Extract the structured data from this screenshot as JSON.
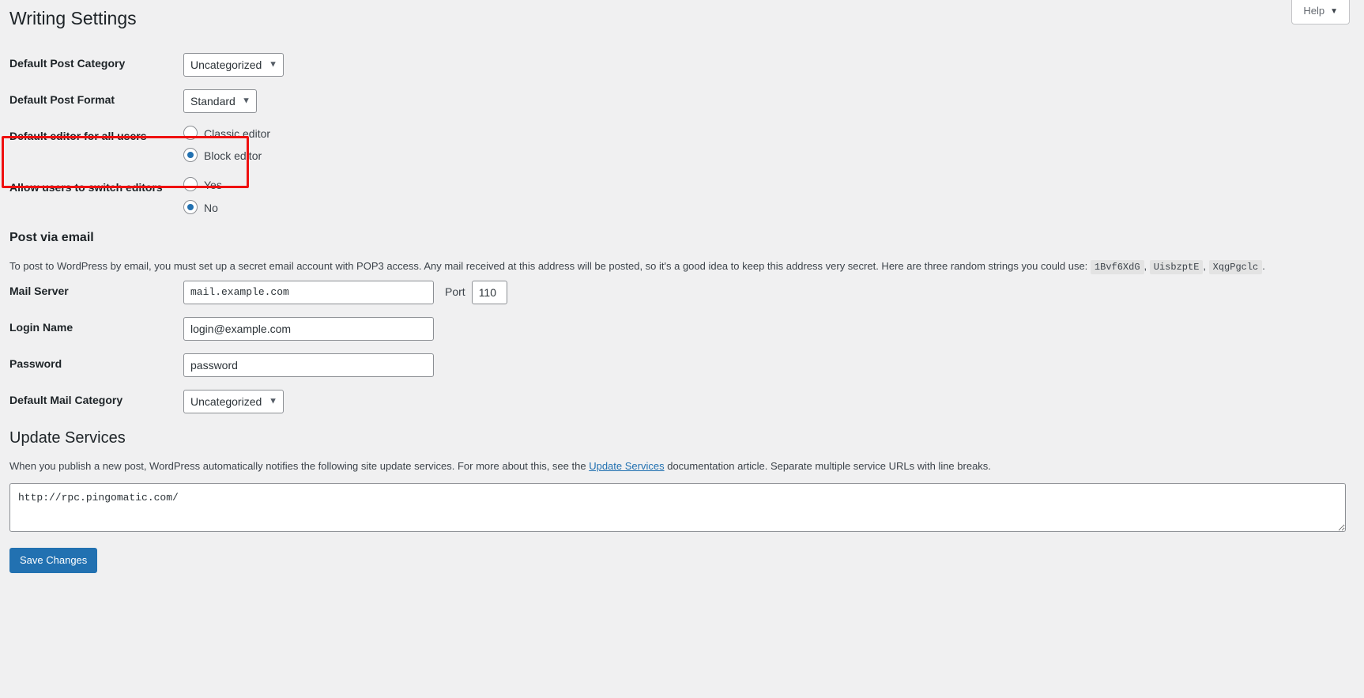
{
  "help_tab": {
    "label": "Help",
    "caret": "chevron-down-icon"
  },
  "page": {
    "title": "Writing Settings"
  },
  "fields": {
    "default_post_category": {
      "label": "Default Post Category",
      "value": "Uncategorized",
      "options": [
        "Uncategorized"
      ]
    },
    "default_post_format": {
      "label": "Default Post Format",
      "value": "Standard",
      "options": [
        "Standard"
      ]
    },
    "default_editor": {
      "label": "Default editor for all users",
      "options": [
        {
          "label": "Classic editor",
          "checked": false
        },
        {
          "label": "Block editor",
          "checked": true
        }
      ]
    },
    "allow_switch_editors": {
      "label": "Allow users to switch editors",
      "options": [
        {
          "label": "Yes",
          "checked": false
        },
        {
          "label": "No",
          "checked": true
        }
      ]
    },
    "mail_server": {
      "label": "Mail Server",
      "value": "mail.example.com",
      "port_label": "Port",
      "port_value": "110"
    },
    "login_name": {
      "label": "Login Name",
      "value": "login@example.com"
    },
    "password": {
      "label": "Password",
      "value": "password"
    },
    "default_mail_category": {
      "label": "Default Mail Category",
      "value": "Uncategorized",
      "options": [
        "Uncategorized"
      ]
    }
  },
  "post_via_email": {
    "heading": "Post via email",
    "description_part1": "To post to WordPress by email, you must set up a secret email account with POP3 access. Any mail received at this address will be posted, so it's a good idea to keep this address very secret. Here are three random strings you could use:",
    "random_strings": [
      "1Bvf6XdG",
      "UisbzptE",
      "XqgPgclc"
    ],
    "separator": ",",
    "terminator": "."
  },
  "update_services": {
    "heading": "Update Services",
    "description_part1": "When you publish a new post, WordPress automatically notifies the following site update services. For more about this, see the",
    "link_text": "Update Services",
    "description_part2": "documentation article. Separate multiple service URLs with line breaks.",
    "textarea_value": "http://rpc.pingomatic.com/"
  },
  "submit": {
    "label": "Save Changes"
  },
  "colors": {
    "accent": "#2271b1",
    "highlight": "#ef1010",
    "page_bg": "#f0f0f1",
    "text": "#3c434a"
  }
}
